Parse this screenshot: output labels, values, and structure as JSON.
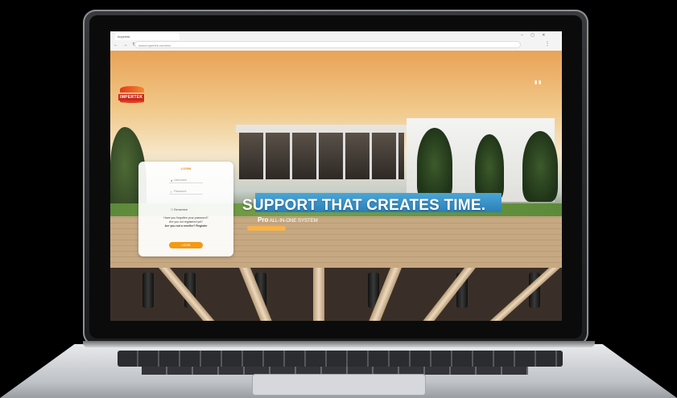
{
  "browser": {
    "tab_title": "Impertek",
    "url": "www.impertek.com/en/",
    "nav_icons": "← → ↻",
    "window_controls": "– ▢ ✕",
    "menu_icon": "⋮"
  },
  "site": {
    "logo_text": "IMPERTEK",
    "language": "▮ ▮"
  },
  "login": {
    "title": "LOGIN",
    "username_placeholder": "Username",
    "password_placeholder": "Password",
    "remember_label": "Remember",
    "text_line1": "Have you forgotten your password?",
    "text_line2": "Are you not registered yet?",
    "text_link": "Are you not a reseller? Register",
    "button_label": "LOGIN"
  },
  "hero": {
    "headline": "SUPPORT THAT CREATES TIME.",
    "sub_brand": "Pro",
    "sub_text": "ALL-IN-ONE SYSTEM",
    "carousel_dots": "● ● ● ●"
  },
  "colors": {
    "accent_orange": "#f39a12",
    "brand_red": "#c9291a"
  }
}
